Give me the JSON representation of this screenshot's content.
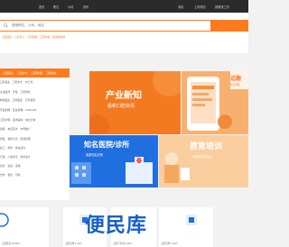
{
  "colors": {
    "accent": "#ff7a1a",
    "topbar": "#2b2b2b",
    "blue": "#1f6fe0"
  },
  "topbar": {
    "left_links": [
      "首页",
      "职位",
      "公司",
      "资讯"
    ],
    "right_links": [
      "消息",
      "上传简历",
      "我要找工作"
    ]
  },
  "search": {
    "placeholder": "搜索职位、公司、地点"
  },
  "hot_tags": [
    "口腔医生",
    "口腔护士",
    "口腔助理",
    "口腔前台",
    "医学美容师"
  ],
  "category": {
    "header": [
      "口腔医生",
      "口腔护士",
      "口腔助理",
      "口腔前台"
    ],
    "rows": [
      [
        "口腔医生",
        "口腔护士",
        "护士长"
      ],
      [
        "主治医师",
        "牙医",
        "口腔修复"
      ],
      [
        "种植医生",
        "正畸医生",
        "正畸医师"
      ],
      [
        "牙医助理",
        "医生助理",
        "CADCAM"
      ],
      [
        "口腔护理",
        "医学美容",
        "前台咨询"
      ],
      [
        "客服",
        "电话回访",
        "市场推广"
      ],
      [
        "导医",
        "销售代表",
        "区域经理"
      ],
      [
        "技工",
        "质检",
        "前台接待"
      ],
      [
        "行政",
        "人事专员",
        "财务会计"
      ],
      [
        "店长",
        "运营",
        "采购"
      ],
      [
        "仓管",
        "保洁",
        "司机"
      ]
    ]
  },
  "banner1": {
    "title": "产业新知",
    "subtitle": "最新口腔资讯"
  },
  "topic": {
    "title": "话题",
    "subtitle": "热点话题"
  },
  "banner2": {
    "title": "知名医院/诊所",
    "subtitle": "各家知名诊所"
  },
  "banner3": {
    "title": "教育培训",
    "subtitle": "口腔医学生培训"
  },
  "bottom": {
    "watermark": "便民库",
    "cards": [
      {
        "caption": "口腔医生 20-30人"
      },
      {
        "caption": "口腔诊所 1-20人"
      },
      {
        "caption": "口腔门诊部 1-20人"
      },
      {
        "caption": "口腔诊所 1-20人"
      }
    ]
  }
}
